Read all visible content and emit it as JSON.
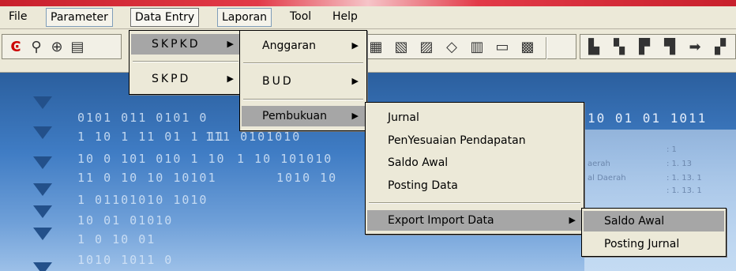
{
  "menubar": {
    "items": [
      "File",
      "Parameter",
      "Data Entry",
      "Laporan",
      "Tool",
      "Help"
    ]
  },
  "toolbar": {
    "icons": [
      "close-icon",
      "search-icon",
      "lock-icon",
      "document-icon"
    ]
  },
  "background": {
    "binary_left": [
      "0101 011 0101 0",
      "1 10 1 11 01 1 11",
      "10 0 101 010 1 10",
      "11 0 10  10 10101",
      "1 01101010  1010",
      "10 01 01010",
      "1 0 10 01",
      "1010 1011 0"
    ],
    "binary_left_tail": [
      "",
      "111 0101010",
      "1 10 101010",
      "1010  10",
      "",
      "",
      "",
      ""
    ],
    "binary_right": "10 01 01 1011",
    "card_lines": [
      ": 1",
      ": 1. 13",
      ": 1. 13. 1",
      ": 1. 13. 1"
    ],
    "card_labels": [
      "aerah",
      "al Daerah"
    ]
  },
  "menu_data_entry": {
    "items": [
      "SKPKD",
      "SKPD"
    ]
  },
  "menu_skpkd": {
    "items": [
      "Anggaran",
      "BUD",
      "Pembukuan"
    ]
  },
  "menu_pembukuan": {
    "items": [
      "Jurnal",
      "PenYesuaian Pendapatan",
      "Saldo Awal",
      "Posting Data",
      "Export Import Data"
    ]
  },
  "menu_export_import": {
    "items": [
      "Saldo Awal",
      "Posting Jurnal"
    ]
  },
  "colors": {
    "menu_bg": "#ece9d8",
    "highlight": "#a6a6a6",
    "desktop_blue": "#3f7cc4",
    "accent_red": "#c8202c"
  }
}
